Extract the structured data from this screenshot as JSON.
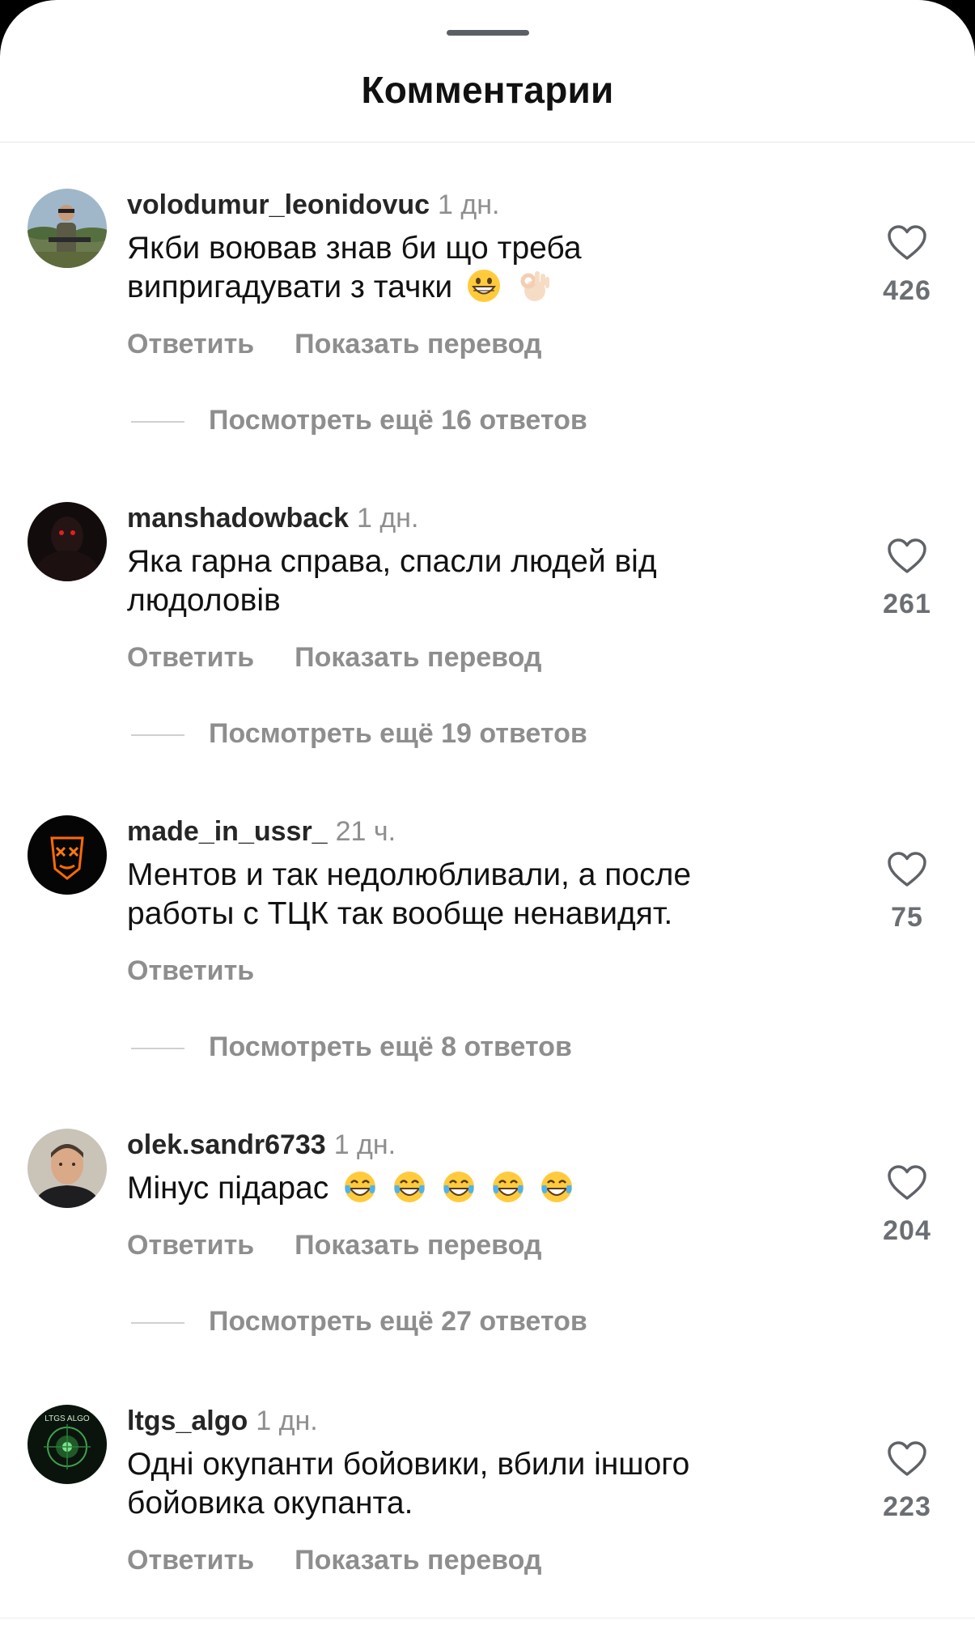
{
  "header": {
    "title": "Комментарии"
  },
  "comments": [
    {
      "username": "volodumur_leonidovuc",
      "time": "1 дн.",
      "text": "Якби воював знав би що треба випригадувати з тачки",
      "emojis": [
        "grinning-face",
        "ok-hand"
      ],
      "reply_label": "Ответить",
      "translate_label": "Показать перевод",
      "likes": "426",
      "view_replies": "Посмотреть ещё 16 ответов"
    },
    {
      "username": "manshadowback",
      "time": "1 дн.",
      "text": "Яка гарна справа, спасли людей від людоловів",
      "emojis": [],
      "reply_label": "Ответить",
      "translate_label": "Показать перевод",
      "likes": "261",
      "view_replies": "Посмотреть ещё 19 ответов"
    },
    {
      "username": "made_in_ussr_",
      "time": "21 ч.",
      "text": "Ментов и так недолюбливали, а после работы с ТЦК так вообще ненавидят.",
      "emojis": [],
      "reply_label": "Ответить",
      "translate_label": "",
      "likes": "75",
      "view_replies": "Посмотреть ещё 8 ответов"
    },
    {
      "username": "olek.sandr6733",
      "time": "1 дн.",
      "text": "Мінус підарас",
      "emojis": [
        "tears-of-joy",
        "tears-of-joy",
        "tears-of-joy",
        "tears-of-joy",
        "tears-of-joy"
      ],
      "reply_label": "Ответить",
      "translate_label": "Показать перевод",
      "likes": "204",
      "view_replies": "Посмотреть ещё 27 ответов"
    },
    {
      "username": "ltgs_algo",
      "time": "1 дн.",
      "text": "Одні окупанти бойовики, вбили іншого бойовика окупанта.",
      "emojis": [],
      "reply_label": "Ответить",
      "translate_label": "Показать перевод",
      "likes": "223",
      "view_replies": "",
      "avatar_text": "LTGS ALGO"
    }
  ]
}
